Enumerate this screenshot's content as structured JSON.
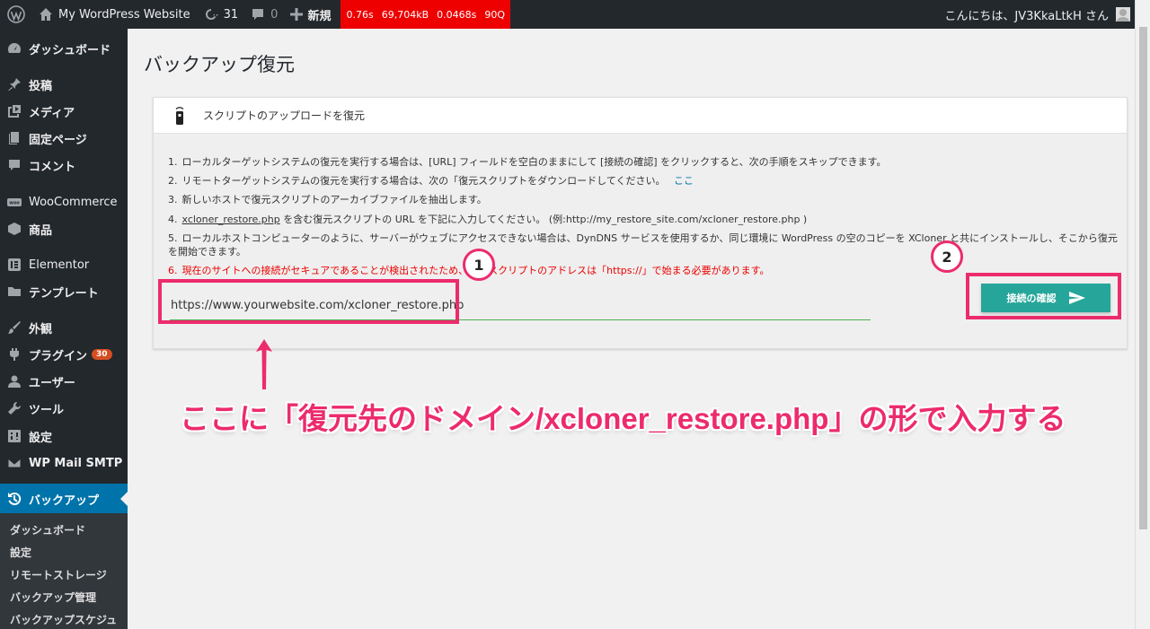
{
  "adminbar": {
    "site_name": "My WordPress Website",
    "updates_count": "31",
    "comments_count": "0",
    "new_label": "新規",
    "perf": [
      "0.76s",
      "69,704kB",
      "0.0468s",
      "90Q"
    ],
    "greeting": "こんにちは、JV3KkaLtkH さん"
  },
  "sidebar": {
    "items": [
      {
        "label": "ダッシュボード",
        "icon": "dashboard-icon"
      },
      {
        "label": "投稿",
        "icon": "pin-icon"
      },
      {
        "label": "メディア",
        "icon": "media-icon"
      },
      {
        "label": "固定ページ",
        "icon": "page-icon"
      },
      {
        "label": "コメント",
        "icon": "comment-icon"
      },
      {
        "label": "WooCommerce",
        "icon": "woo-icon"
      },
      {
        "label": "商品",
        "icon": "box-icon"
      },
      {
        "label": "Elementor",
        "icon": "elementor-icon"
      },
      {
        "label": "テンプレート",
        "icon": "folder-icon"
      },
      {
        "label": "外観",
        "icon": "brush-icon"
      },
      {
        "label": "プラグイン",
        "icon": "plugin-icon",
        "badge": "30"
      },
      {
        "label": "ユーザー",
        "icon": "user-icon"
      },
      {
        "label": "ツール",
        "icon": "wrench-icon"
      },
      {
        "label": "設定",
        "icon": "settings-icon"
      },
      {
        "label": "WP Mail SMTP",
        "icon": "mail-icon"
      },
      {
        "label": "バックアップ",
        "icon": "backup-icon"
      }
    ],
    "submenu": [
      "ダッシュボード",
      "設定",
      "リモートストレージ",
      "バックアップ管理",
      "バックアップスケジュ"
    ]
  },
  "page": {
    "title": "バックアップ復元",
    "card_title": "スクリプトのアップロードを復元",
    "steps": [
      {
        "num": "1.",
        "text": "ローカルターゲットシステムの復元を実行する場合は、[URL] フィールドを空白のままにして [接続の確認] をクリックすると、次の手順をスキップできます。"
      },
      {
        "num": "2.",
        "text": "リモートターゲットシステムの復元を実行する場合は、次の「復元スクリプトをダウンロードしてください。",
        "link": "ここ"
      },
      {
        "num": "3.",
        "text": "新しいホストで復元スクリプトのアーカイブファイルを抽出します。"
      },
      {
        "num": "4.",
        "u": "xcloner_restore.php",
        "text": " を含む復元スクリプトの URL を下記に入力してください。 (例:http://my_restore_site.com/xcloner_restore.php )"
      },
      {
        "num": "5.",
        "text": "ローカルホストコンピューターのように、サーバーがウェブにアクセスできない場合は、DynDNS サービスを使用するか、同じ環境に WordPress の空のコピーを XCloner と共にインストールし、そこから復元を開始できます。"
      },
      {
        "num": "6.",
        "text": "現在のサイトへの接続がセキュアであることが検出されたため、復元スクリプトのアドレスは「https://」で始まる必要があります。"
      }
    ],
    "url_value": "https://www.yourwebsite.com/xcloner_restore.php",
    "confirm_label": "接続の確認"
  },
  "annotations": {
    "marker1": "1",
    "marker2": "2",
    "callout": "ここに「復元先のドメイン/xcloner_restore.php」の形で入力する",
    "color": "#ec2b6d"
  }
}
